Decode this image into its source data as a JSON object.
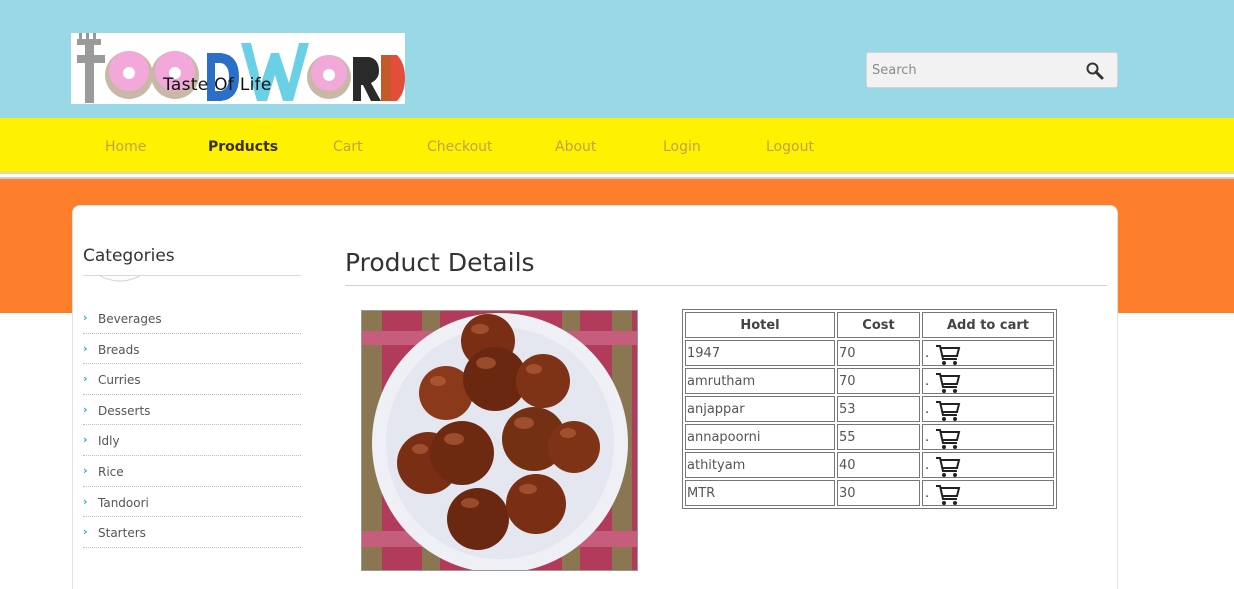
{
  "logo": {
    "tagline": "Taste Of Life",
    "brand_text": "FOODWORLD"
  },
  "search": {
    "placeholder": "Search"
  },
  "nav": {
    "items": [
      {
        "label": "Home"
      },
      {
        "label": "Products",
        "active": true
      },
      {
        "label": "Cart"
      },
      {
        "label": "Checkout"
      },
      {
        "label": "About"
      },
      {
        "label": "Login"
      },
      {
        "label": "Logout"
      }
    ]
  },
  "sidebar": {
    "title": "Categories",
    "items": [
      {
        "label": "Beverages"
      },
      {
        "label": "Breads"
      },
      {
        "label": "Curries"
      },
      {
        "label": "Desserts"
      },
      {
        "label": "Idly"
      },
      {
        "label": "Rice"
      },
      {
        "label": "Tandoori"
      },
      {
        "label": "Starters"
      }
    ]
  },
  "main": {
    "title": "Product Details",
    "table": {
      "headers": [
        "Hotel",
        "Cost",
        "Add to cart"
      ],
      "rows": [
        {
          "hotel": "1947",
          "cost": "70"
        },
        {
          "hotel": "amrutham",
          "cost": "70"
        },
        {
          "hotel": "anjappar",
          "cost": "53"
        },
        {
          "hotel": "annapoorni",
          "cost": "55"
        },
        {
          "hotel": "athityam",
          "cost": "40"
        },
        {
          "hotel": "MTR",
          "cost": "30"
        }
      ],
      "cart_prefix": "."
    }
  },
  "colors": {
    "header_bg": "#99d8e6",
    "nav_bg": "#fff200",
    "nav_text": "#bfa34a",
    "nav_active": "#3a3010",
    "strip_bg": "#fd7f2b",
    "bullet": "#2aa8e0"
  },
  "icons": {
    "search": "magnifier-icon",
    "cart": "shopping-cart-icon"
  }
}
